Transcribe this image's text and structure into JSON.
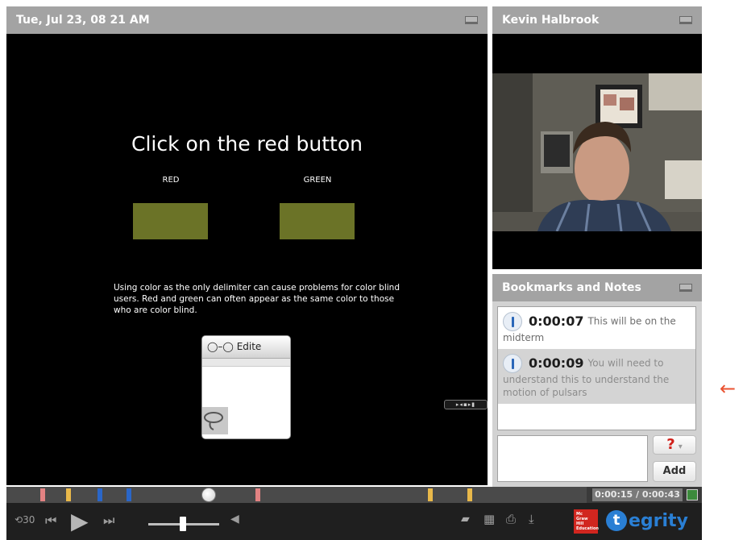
{
  "slide_panel": {
    "header": "Tue, Jul 23, 08 21 AM",
    "title": "Click on the red button",
    "swatch_left_label": "RED",
    "swatch_right_label": "GREEN",
    "swatch_color": "#6b7327",
    "body": "Using color as the only delimiter can cause problems for color blind users.  Red and green can often appear as the same color to those who are color blind.",
    "mini_window_title": "Edite"
  },
  "video_panel": {
    "header": "Kevin Halbrook"
  },
  "bookmarks": {
    "header": "Bookmarks and Notes",
    "items": [
      {
        "time": "0:00:07",
        "text": "This will be on the midterm"
      },
      {
        "time": "0:00:09",
        "text": "You will need to understand this to understand the motion of pulsars"
      }
    ],
    "note_placeholder": "",
    "help_label": "?",
    "add_label": "Add"
  },
  "timeline": {
    "readout": "0:00:15 / 0:00:43",
    "elapsed_seconds": 15,
    "duration_seconds": 43,
    "marker_colors": [
      "#e28282",
      "#e8b84a",
      "#2a66c8",
      "#2a66c8",
      "#e28282",
      "#e8b84a",
      "#e8b84a"
    ]
  },
  "controls": {
    "back_label": "30",
    "logo_text": "egrity",
    "logo_badge": "t",
    "publisher_text": "Mc Graw Hill Education"
  },
  "colors": {
    "header_gray": "#a3a3a3",
    "accent_blue": "#2a7fd4",
    "pointer_orange": "#ea5230"
  }
}
